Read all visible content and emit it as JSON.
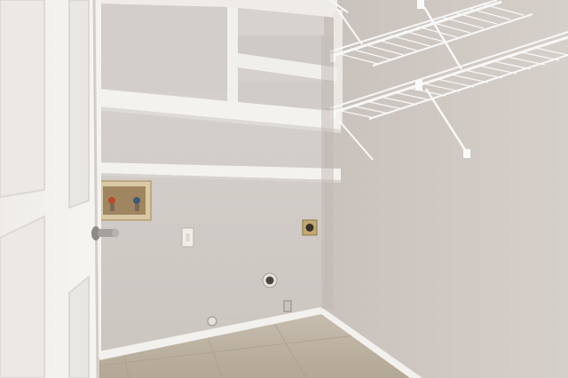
{
  "scene": {
    "kind": "photograph",
    "colors": {
      "back_wall": "#d6d1cc",
      "right_wall": "#cfc8c2",
      "ceiling": "#e2ddd8",
      "shelf": "#f2f0ec",
      "door": "#f4f2ef",
      "trim": "#f5f3f0",
      "floor": "#bdb2a2",
      "wire_rack": "#f7f7f7"
    },
    "objects": [
      "door-open",
      "door-handle",
      "built-in-shelves",
      "wire-shelf-racks",
      "washer-valve-box",
      "dryer-outlet",
      "light-switch",
      "dryer-vent",
      "baseboard",
      "tile-floor"
    ]
  }
}
